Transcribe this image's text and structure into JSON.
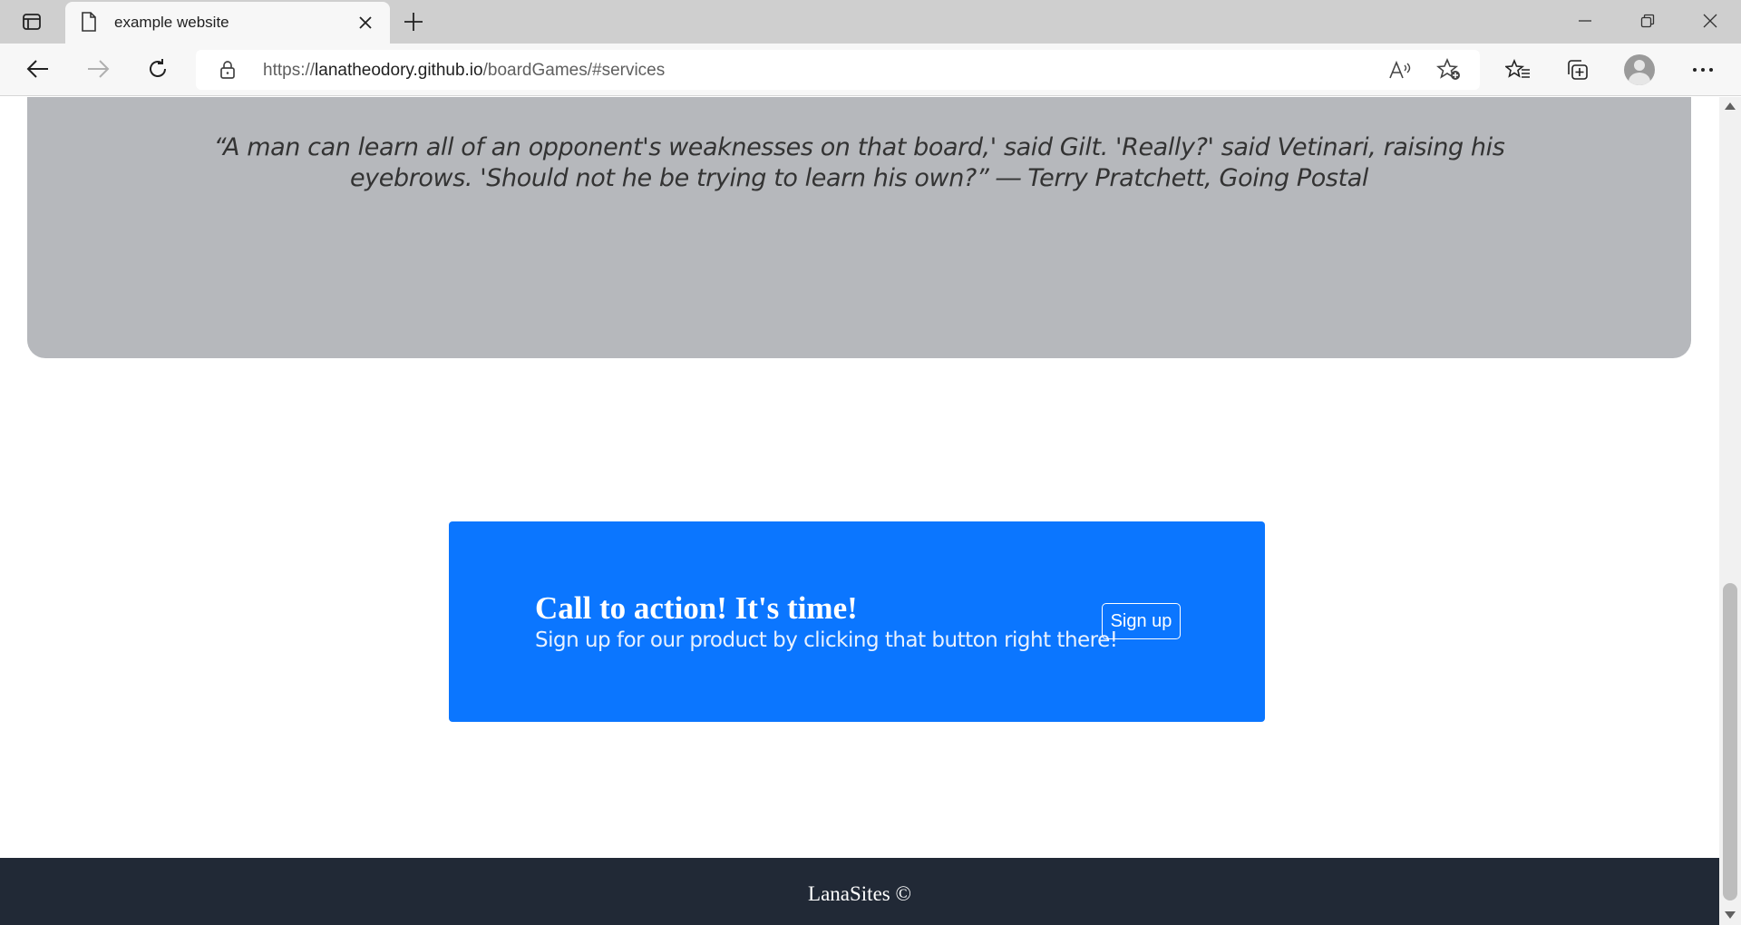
{
  "browser": {
    "tab_title": "example website",
    "url_scheme": "https://",
    "url_host": "lanatheodory.github.io",
    "url_path": "/boardGames/#services",
    "icons": [
      "tab-actions-icon",
      "page-icon",
      "close-icon",
      "plus-icon",
      "minimize-icon",
      "restore-icon",
      "window-close-icon",
      "back-arrow-icon",
      "forward-arrow-icon",
      "refresh-icon",
      "lock-icon",
      "read-aloud-icon",
      "add-favorite-icon",
      "favorites-icon",
      "collections-icon",
      "profile-avatar",
      "more-icon"
    ]
  },
  "page": {
    "quote": "“A man can learn all of an opponent's weaknesses on that board,' said Gilt. 'Really?' said Vetinari, raising his eyebrows. 'Should not he be trying to learn his own?” ― Terry Pratchett, Going Postal",
    "cta": {
      "title": "Call to action! It's time!",
      "subtitle": "Sign up for our product by clicking that button right there!",
      "button_label": "Sign up"
    },
    "footer_text": "LanaSites ©"
  },
  "colors": {
    "quote_background": "#b6b8bc",
    "cta_background": "#0b76ff",
    "footer_background": "#212936"
  }
}
